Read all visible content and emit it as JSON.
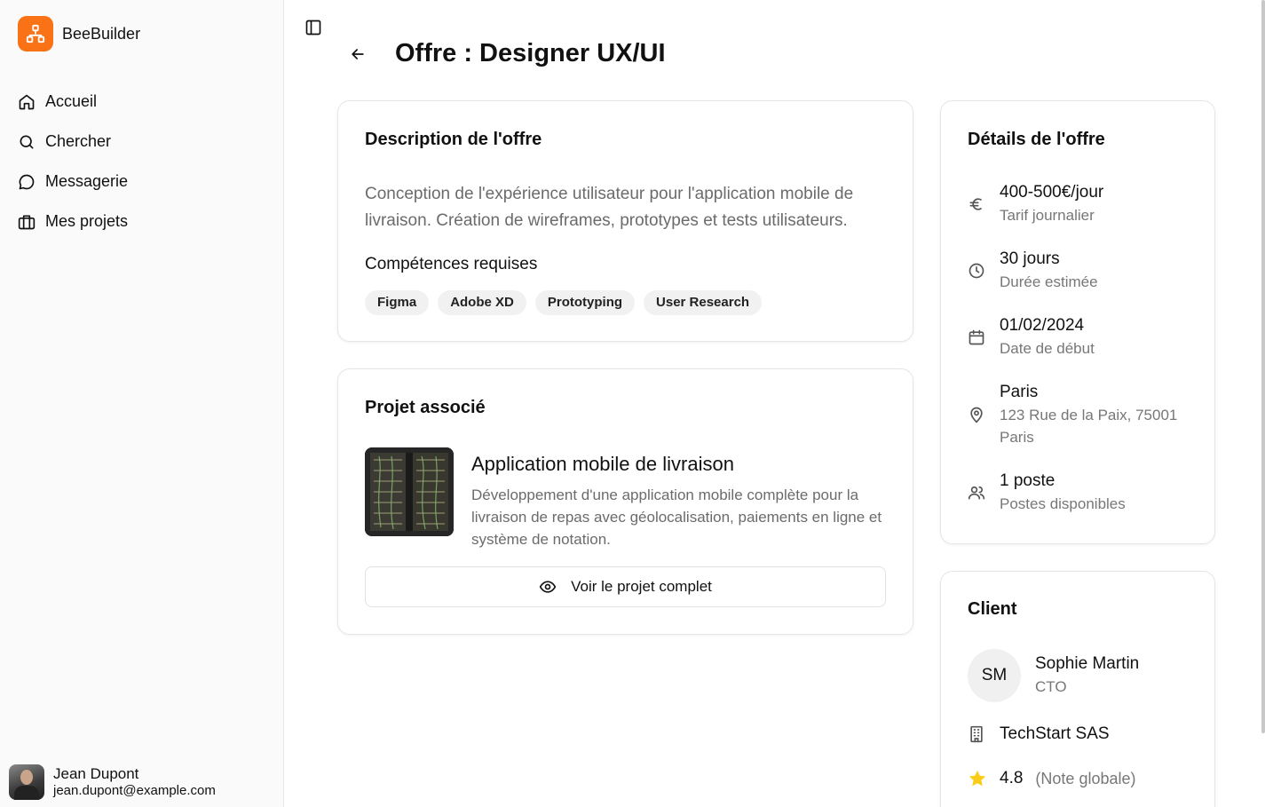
{
  "brand": {
    "name": "BeeBuilder"
  },
  "nav": [
    {
      "label": "Accueil",
      "icon": "home-icon"
    },
    {
      "label": "Chercher",
      "icon": "search-icon"
    },
    {
      "label": "Messagerie",
      "icon": "message-icon"
    },
    {
      "label": "Mes projets",
      "icon": "briefcase-icon"
    }
  ],
  "user": {
    "name": "Jean Dupont",
    "email": "jean.dupont@example.com"
  },
  "page": {
    "title": "Offre : Designer UX/UI"
  },
  "description": {
    "title": "Description de l'offre",
    "text": "Conception de l'expérience utilisateur pour l'application mobile de livraison. Création de wireframes, prototypes et tests utilisateurs.",
    "skills_label": "Compétences requises",
    "skills": [
      "Figma",
      "Adobe XD",
      "Prototyping",
      "User Research"
    ]
  },
  "project": {
    "title": "Projet associé",
    "name": "Application mobile de livraison",
    "desc": "Développement d'une application mobile complète pour la livraison de repas avec géolocalisation, paiements en ligne et système de notation.",
    "button": "Voir le projet complet"
  },
  "details": {
    "title": "Détails de l'offre",
    "rate": {
      "value": "400-500€/jour",
      "label": "Tarif journalier"
    },
    "duration": {
      "value": "30 jours",
      "label": "Durée estimée"
    },
    "start": {
      "value": "01/02/2024",
      "label": "Date de début"
    },
    "location": {
      "value": "Paris",
      "label": "123 Rue de la Paix, 75001 Paris"
    },
    "positions": {
      "value": "1 poste",
      "label": "Postes disponibles"
    }
  },
  "client": {
    "title": "Client",
    "initials": "SM",
    "name": "Sophie Martin",
    "role": "CTO",
    "company": "TechStart SAS",
    "rating": "4.8",
    "rating_note": "(Note globale)"
  },
  "colors": {
    "brand": "#f97316",
    "star": "#facc15",
    "muted": "#6b6b6b"
  }
}
